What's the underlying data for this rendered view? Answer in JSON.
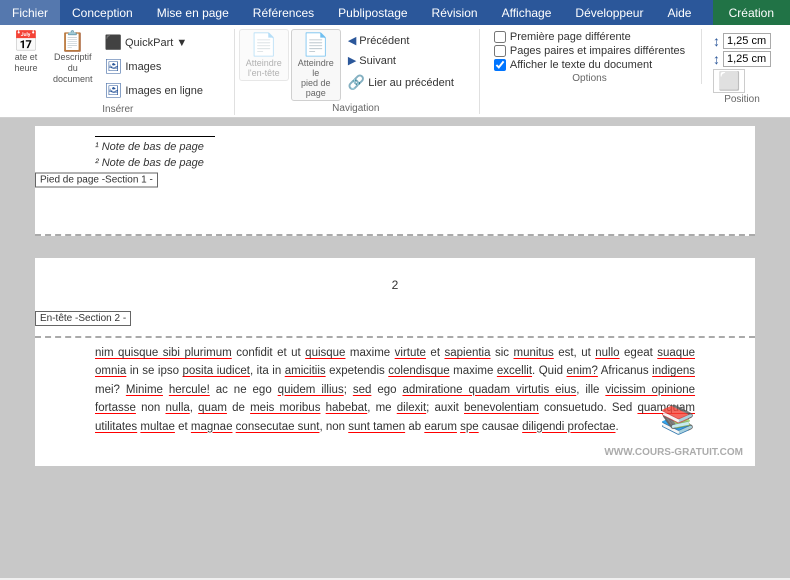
{
  "menubar": {
    "items": [
      {
        "id": "fichier",
        "label": "Fichier"
      },
      {
        "id": "conception",
        "label": "Conception"
      },
      {
        "id": "mise_en_page",
        "label": "Mise en page"
      },
      {
        "id": "references",
        "label": "Références"
      },
      {
        "id": "publipostage",
        "label": "Publipostage"
      },
      {
        "id": "revision",
        "label": "Révision"
      },
      {
        "id": "affichage",
        "label": "Affichage"
      },
      {
        "id": "developpeur",
        "label": "Développeur"
      },
      {
        "id": "aide",
        "label": "Aide"
      }
    ],
    "active_tab": "Creation",
    "active_label": "Création"
  },
  "ribbon": {
    "groups": {
      "inserer": {
        "label": "Insérer",
        "btn_left_icon": "📄",
        "btn_left_label": "ate et\nheure",
        "btn_right_icon": "📋",
        "btn_right_label": "Descriptif du\ndocument",
        "sub_items": [
          {
            "icon": "⬛",
            "label": "QuickPart ▼"
          },
          {
            "icon": "🖼",
            "label": "Images"
          },
          {
            "icon": "🖼",
            "label": "Images en ligne"
          }
        ]
      },
      "navigation": {
        "label": "Navigation",
        "btn_atteindre_entete": "Atteindre\nl'en-tête",
        "btn_atteindre_pied": "Atteindre le\npied de page",
        "sub_items": [
          {
            "icon": "◀",
            "label": "Précédent"
          },
          {
            "icon": "▶",
            "label": "Suivant"
          },
          {
            "icon": "🔗",
            "label": "Lier au précédent"
          }
        ]
      },
      "options": {
        "label": "Options",
        "checkboxes": [
          {
            "id": "premiere_page",
            "label": "Première page différente",
            "checked": false
          },
          {
            "id": "pages_paires",
            "label": "Pages paires et impaires différentes",
            "checked": false
          },
          {
            "id": "afficher_texte",
            "label": "Afficher le texte du document",
            "checked": true
          }
        ]
      },
      "position": {
        "label": "Position",
        "rows": [
          {
            "icon": "↕",
            "value": "1,25 cm"
          },
          {
            "icon": "↕",
            "value": "1,25 cm"
          }
        ],
        "extra_icon": "⬜"
      }
    }
  },
  "document": {
    "footer_section": {
      "label": "Pied de page -Section 1 -",
      "note1": "¹ Note de bas de page",
      "note2": "² Note de bas de page"
    },
    "header_section": {
      "label": "En-tête -Section 2 -",
      "page_number": "2",
      "body_text": "nim quisque sibi plurimum confidit et ut quisque maxime virtute et sapientia sic munitus est, ut nullo egeat suaque omnia in se ipso posita iudicet, ita in amicitiis expetendis colendisque maxime excellit. Quid enim? Africanus indigens mei? Minime hercule! ac ne ego quidem illius; sed ego admiratione quadam virtutis eius, ille vicissim opinione fortasse non nulla, quam de meis moribus habebat, me dilexit; auxit benevolentiam consuetudo. Sed quamquam utilitates multae et magnae consecutae sunt, non sunt tamen ab earum spe causae diligendi profectae."
    }
  },
  "watermark": "WWW.COURS-GRATUIT.COM"
}
